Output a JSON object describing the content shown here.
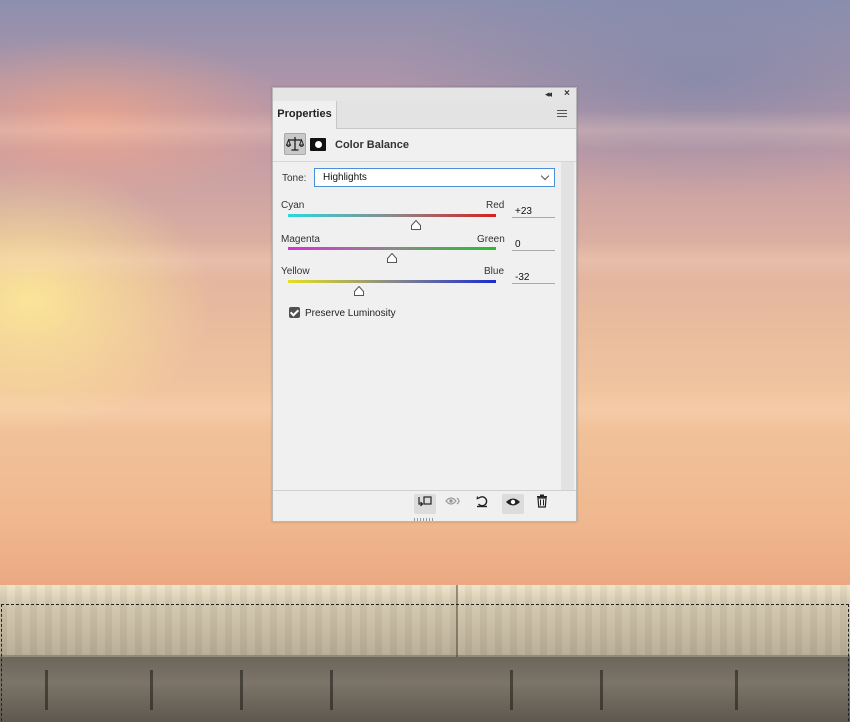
{
  "panel": {
    "tab_label": "Properties",
    "adjustment_title": "Color Balance",
    "tone": {
      "label": "Tone:",
      "value": "Highlights"
    },
    "sliders": [
      {
        "left_label": "Cyan",
        "right_label": "Red",
        "value": "+23",
        "min": -100,
        "max": 100,
        "numeric": 23
      },
      {
        "left_label": "Magenta",
        "right_label": "Green",
        "value": "0",
        "min": -100,
        "max": 100,
        "numeric": 0
      },
      {
        "left_label": "Yellow",
        "right_label": "Blue",
        "value": "-32",
        "min": -100,
        "max": 100,
        "numeric": -32
      }
    ],
    "preserve_luminosity": {
      "label": "Preserve Luminosity",
      "checked": true
    },
    "colors": {
      "cyan": "#2ed6e0",
      "red": "#d42020",
      "magenta": "#d92fd6",
      "green": "#22c22a",
      "yellow": "#e3e020",
      "blue": "#1a2bd0",
      "select_border": "#4a8fd8"
    },
    "footer_icons": [
      "clip-to-layer-icon",
      "view-previous-icon",
      "reset-icon",
      "visibility-icon",
      "trash-icon"
    ]
  }
}
